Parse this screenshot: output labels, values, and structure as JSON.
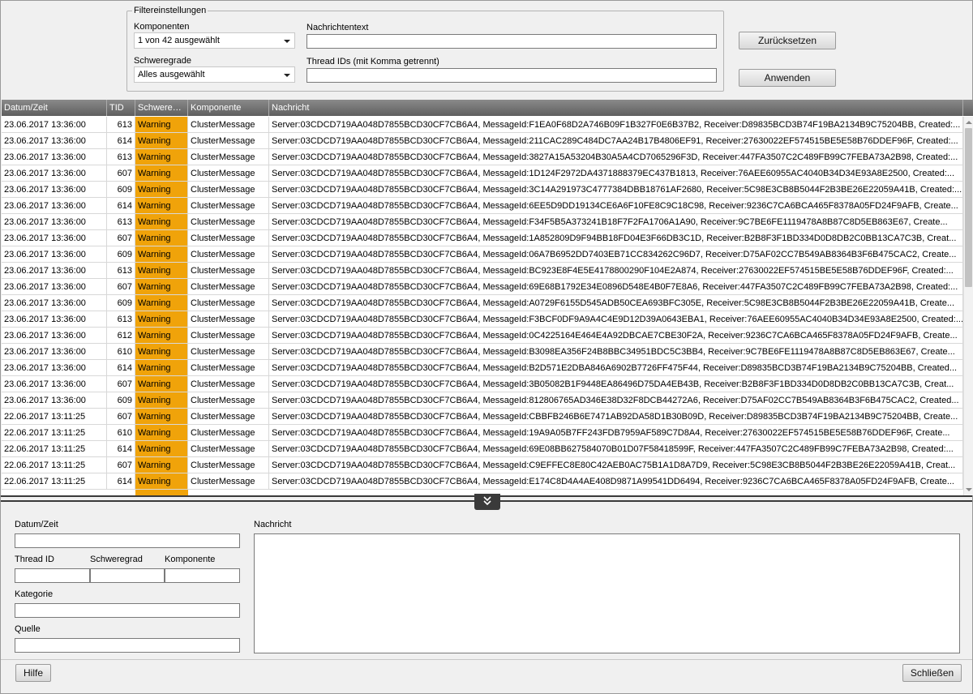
{
  "filter": {
    "legend": "Filtereinstellungen",
    "components_label": "Komponenten",
    "components_value": "1 von 42 ausgewählt",
    "severity_label": "Schweregrade",
    "severity_value": "Alles ausgewählt",
    "message_text_label": "Nachrichtentext",
    "message_text_value": "",
    "thread_ids_label": "Thread IDs (mit Komma getrennt)",
    "thread_ids_value": "",
    "reset_button": "Zurücksetzen",
    "apply_button": "Anwenden"
  },
  "table": {
    "columns": [
      "Datum/Zeit",
      "TID",
      "Schwere…",
      "Komponente",
      "Nachricht"
    ],
    "severity_color": "#f0a30a",
    "rows": [
      {
        "date": "23.06.2017 13:36:00",
        "tid": "613",
        "severity": "Warning",
        "component": "ClusterMessage",
        "message": "Server:03CDCD719AA048D7855BCD30CF7CB6A4, MessageId:F1EA0F68D2A746B09F1B327F0E6B37B2, Receiver:D89835BCD3B74F19BA2134B9C75204BB, Created:..."
      },
      {
        "date": "23.06.2017 13:36:00",
        "tid": "614",
        "severity": "Warning",
        "component": "ClusterMessage",
        "message": "Server:03CDCD719AA048D7855BCD30CF7CB6A4, MessageId:211CAC289C484DC7AA24B17B4806EF91, Receiver:27630022EF574515BE5E58B76DDEF96F, Created:..."
      },
      {
        "date": "23.06.2017 13:36:00",
        "tid": "613",
        "severity": "Warning",
        "component": "ClusterMessage",
        "message": "Server:03CDCD719AA048D7855BCD30CF7CB6A4, MessageId:3827A15A53204B30A5A4CD7065296F3D, Receiver:447FA3507C2C489FB99C7FEBA73A2B98, Created:..."
      },
      {
        "date": "23.06.2017 13:36:00",
        "tid": "607",
        "severity": "Warning",
        "component": "ClusterMessage",
        "message": "Server:03CDCD719AA048D7855BCD30CF7CB6A4, MessageId:1D124F2972DA4371888379EC437B1813, Receiver:76AEE60955AC4040B34D34E93A8E2500, Created:..."
      },
      {
        "date": "23.06.2017 13:36:00",
        "tid": "609",
        "severity": "Warning",
        "component": "ClusterMessage",
        "message": "Server:03CDCD719AA048D7855BCD30CF7CB6A4, MessageId:3C14A291973C4777384DBB18761AF2680, Receiver:5C98E3CB8B5044F2B3BE26E22059A41B, Created:..."
      },
      {
        "date": "23.06.2017 13:36:00",
        "tid": "614",
        "severity": "Warning",
        "component": "ClusterMessage",
        "message": "Server:03CDCD719AA048D7855BCD30CF7CB6A4, MessageId:6EE5D9DD19134CE6A6F10FE8C9C18C98, Receiver:9236C7CA6BCA465F8378A05FD24F9AFB, Create..."
      },
      {
        "date": "23.06.2017 13:36:00",
        "tid": "613",
        "severity": "Warning",
        "component": "ClusterMessage",
        "message": "Server:03CDCD719AA048D7855BCD30CF7CB6A4, MessageId:F34F5B5A373241B18F7F2FA1706A1A90, Receiver:9C7BE6FE1119478A8B87C8D5EB863E67, Create..."
      },
      {
        "date": "23.06.2017 13:36:00",
        "tid": "607",
        "severity": "Warning",
        "component": "ClusterMessage",
        "message": "Server:03CDCD719AA048D7855BCD30CF7CB6A4, MessageId:1A852809D9F94BB18FD04E3F66DB3C1D, Receiver:B2B8F3F1BD334D0D8DB2C0BB13CA7C3B, Creat..."
      },
      {
        "date": "23.06.2017 13:36:00",
        "tid": "609",
        "severity": "Warning",
        "component": "ClusterMessage",
        "message": "Server:03CDCD719AA048D7855BCD30CF7CB6A4, MessageId:06A7B6952DD7403EB71CC834262C96D7, Receiver:D75AF02CC7B549AB8364B3F6B475CAC2, Create..."
      },
      {
        "date": "23.06.2017 13:36:00",
        "tid": "613",
        "severity": "Warning",
        "component": "ClusterMessage",
        "message": "Server:03CDCD719AA048D7855BCD30CF7CB6A4, MessageId:BC923E8F4E5E4178800290F104E2A874, Receiver:27630022EF574515BE5E58B76DDEF96F, Created:..."
      },
      {
        "date": "23.06.2017 13:36:00",
        "tid": "607",
        "severity": "Warning",
        "component": "ClusterMessage",
        "message": "Server:03CDCD719AA048D7855BCD30CF7CB6A4, MessageId:69E68B1792E34E0896D548E4B0F7E8A6, Receiver:447FA3507C2C489FB99C7FEBA73A2B98, Created:..."
      },
      {
        "date": "23.06.2017 13:36:00",
        "tid": "609",
        "severity": "Warning",
        "component": "ClusterMessage",
        "message": "Server:03CDCD719AA048D7855BCD30CF7CB6A4, MessageId:A0729F6155D545ADB50CEA693BFC305E, Receiver:5C98E3CB8B5044F2B3BE26E22059A41B, Create..."
      },
      {
        "date": "23.06.2017 13:36:00",
        "tid": "613",
        "severity": "Warning",
        "component": "ClusterMessage",
        "message": "Server:03CDCD719AA048D7855BCD30CF7CB6A4, MessageId:F3BCF0DF9A9A4C4E9D12D39A0643EBA1, Receiver:76AEE60955AC4040B34D34E93A8E2500, Created:..."
      },
      {
        "date": "23.06.2017 13:36:00",
        "tid": "612",
        "severity": "Warning",
        "component": "ClusterMessage",
        "message": "Server:03CDCD719AA048D7855BCD30CF7CB6A4, MessageId:0C4225164E464E4A92DBCAE7CBE30F2A, Receiver:9236C7CA6BCA465F8378A05FD24F9AFB, Create..."
      },
      {
        "date": "23.06.2017 13:36:00",
        "tid": "610",
        "severity": "Warning",
        "component": "ClusterMessage",
        "message": "Server:03CDCD719AA048D7855BCD30CF7CB6A4, MessageId:B3098EA356F24B8BBC34951BDC5C3BB4, Receiver:9C7BE6FE1119478A8B87C8D5EB863E67, Create..."
      },
      {
        "date": "23.06.2017 13:36:00",
        "tid": "614",
        "severity": "Warning",
        "component": "ClusterMessage",
        "message": "Server:03CDCD719AA048D7855BCD30CF7CB6A4, MessageId:B2D571E2DBA846A6902B7726FF475F44, Receiver:D89835BCD3B74F19BA2134B9C75204BB, Created..."
      },
      {
        "date": "23.06.2017 13:36:00",
        "tid": "607",
        "severity": "Warning",
        "component": "ClusterMessage",
        "message": "Server:03CDCD719AA048D7855BCD30CF7CB6A4, MessageId:3B05082B1F9448EA86496D75DA4EB43B, Receiver:B2B8F3F1BD334D0D8DB2C0BB13CA7C3B, Creat..."
      },
      {
        "date": "23.06.2017 13:36:00",
        "tid": "609",
        "severity": "Warning",
        "component": "ClusterMessage",
        "message": "Server:03CDCD719AA048D7855BCD30CF7CB6A4, MessageId:812806765AD346E38D32F8DCB44272A6, Receiver:D75AF02CC7B549AB8364B3F6B475CAC2, Created..."
      },
      {
        "date": "22.06.2017 13:11:25",
        "tid": "607",
        "severity": "Warning",
        "component": "ClusterMessage",
        "message": "Server:03CDCD719AA048D7855BCD30CF7CB6A4, MessageId:CBBFB246B6E7471AB92DA58D1B30B09D, Receiver:D89835BCD3B74F19BA2134B9C75204BB, Create..."
      },
      {
        "date": "22.06.2017 13:11:25",
        "tid": "610",
        "severity": "Warning",
        "component": "ClusterMessage",
        "message": "Server:03CDCD719AA048D7855BCD30CF7CB6A4, MessageId:19A9A05B7FF243FDB7959AF589C7D8A4, Receiver:27630022EF574515BE5E58B76DDEF96F, Create..."
      },
      {
        "date": "22.06.2017 13:11:25",
        "tid": "614",
        "severity": "Warning",
        "component": "ClusterMessage",
        "message": "Server:03CDCD719AA048D7855BCD30CF7CB6A4, MessageId:69E08BB627584070B01D07F58418599F, Receiver:447FA3507C2C489FB99C7FEBA73A2B98, Created:..."
      },
      {
        "date": "22.06.2017 13:11:25",
        "tid": "607",
        "severity": "Warning",
        "component": "ClusterMessage",
        "message": "Server:03CDCD719AA048D7855BCD30CF7CB6A4, MessageId:C9EFFEC8E80C42AEB0AC75B1A1D8A7D9, Receiver:5C98E3CB8B5044F2B3BE26E22059A41B, Creat..."
      },
      {
        "date": "22.06.2017 13:11:25",
        "tid": "614",
        "severity": "Warning",
        "component": "ClusterMessage",
        "message": "Server:03CDCD719AA048D7855BCD30CF7CB6A4, MessageId:E174C8D4A4AE408D9871A99541DD6494, Receiver:9236C7CA6BCA465F8378A05FD24F9AFB, Create..."
      }
    ]
  },
  "detail": {
    "datetime_label": "Datum/Zeit",
    "thread_id_label": "Thread ID",
    "severity_label": "Schweregrad",
    "component_label": "Komponente",
    "category_label": "Kategorie",
    "source_label": "Quelle",
    "message_label": "Nachricht"
  },
  "footer": {
    "help_button": "Hilfe",
    "close_button": "Schließen"
  },
  "icons": {
    "dropdown": "chevron-down-icon",
    "splitter": "double-chevron-down-icon"
  }
}
